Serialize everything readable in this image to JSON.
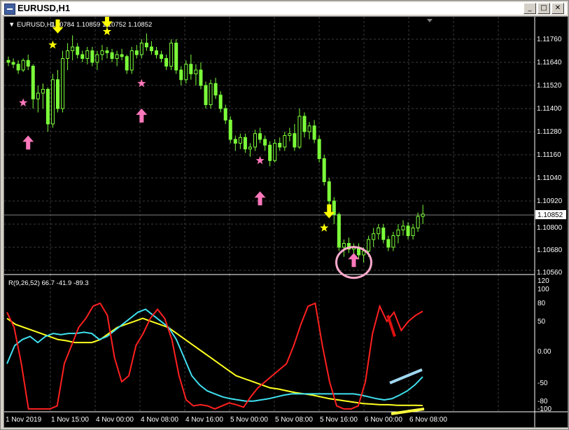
{
  "window": {
    "title": "EURUSD,H1",
    "buttons": {
      "minimize": "_",
      "maximize": "□",
      "close": "✕"
    }
  },
  "price_panel": {
    "header_symbol": "▼ EURUSD,H1",
    "header_ohlc": "1.10784 1.10859 1.10752 1.10852",
    "price_ticks": [
      "1.11760",
      "1.11640",
      "1.11520",
      "1.11400",
      "1.11280",
      "1.11160",
      "1.11040",
      "1.10920",
      "1.10800",
      "1.10680",
      "1.10560"
    ],
    "current_price": "1.10852"
  },
  "indicator_panel": {
    "label": "R(9,26,52) 66.7 -41.9 -89.3",
    "ticks": [
      "120",
      "100",
      "80",
      "50",
      "0.00",
      "-50",
      "-80",
      "-100"
    ]
  },
  "time_axis": [
    "1 Nov 2019",
    "1 Nov 15:00",
    "4 Nov 00:00",
    "4 Nov 08:00",
    "4 Nov 16:00",
    "5 Nov 00:00",
    "5 Nov 08:00",
    "5 Nov 16:00",
    "6 Nov 00:00",
    "6 Nov 08:00"
  ],
  "colors": {
    "background": "#000000",
    "grid": "#3a3a3a",
    "candle": "#7cff3a",
    "red_line": "#ff2020",
    "cyan_line": "#40e0f0",
    "yellow_line": "#ffff20",
    "buy_arrow": "#ff77bb",
    "sell_arrow": "#ffff00"
  },
  "chart_data": {
    "type": "candlestick",
    "title": "EURUSD,H1",
    "ylim": [
      1.105,
      1.118
    ],
    "candles": [
      [
        1.1165,
        1.1167,
        1.1162,
        1.1164
      ],
      [
        1.1164,
        1.1166,
        1.1161,
        1.1163
      ],
      [
        1.1163,
        1.1165,
        1.1158,
        1.116
      ],
      [
        1.116,
        1.1166,
        1.1159,
        1.1165
      ],
      [
        1.1165,
        1.1168,
        1.116,
        1.1162
      ],
      [
        1.1162,
        1.1163,
        1.114,
        1.1145
      ],
      [
        1.1145,
        1.1152,
        1.1138,
        1.1148
      ],
      [
        1.1148,
        1.1153,
        1.114,
        1.115
      ],
      [
        1.115,
        1.1151,
        1.1128,
        1.1132
      ],
      [
        1.1132,
        1.1158,
        1.113,
        1.1155
      ],
      [
        1.1155,
        1.116,
        1.1138,
        1.114
      ],
      [
        1.114,
        1.117,
        1.1138,
        1.1166
      ],
      [
        1.1166,
        1.1174,
        1.116,
        1.117
      ],
      [
        1.117,
        1.1178,
        1.1165,
        1.1172
      ],
      [
        1.1172,
        1.1174,
        1.1166,
        1.1168
      ],
      [
        1.1168,
        1.117,
        1.1164,
        1.1166
      ],
      [
        1.1166,
        1.1172,
        1.1163,
        1.117
      ],
      [
        1.117,
        1.1172,
        1.1162,
        1.1164
      ],
      [
        1.1164,
        1.117,
        1.116,
        1.1168
      ],
      [
        1.1168,
        1.1173,
        1.1165,
        1.117
      ],
      [
        1.117,
        1.1172,
        1.1166,
        1.1169
      ],
      [
        1.1169,
        1.1171,
        1.1164,
        1.1166
      ],
      [
        1.1166,
        1.117,
        1.1162,
        1.1168
      ],
      [
        1.1168,
        1.1171,
        1.1165,
        1.1167
      ],
      [
        1.1167,
        1.1168,
        1.1158,
        1.116
      ],
      [
        1.116,
        1.1172,
        1.1158,
        1.117
      ],
      [
        1.117,
        1.1173,
        1.1166,
        1.1168
      ],
      [
        1.1168,
        1.1176,
        1.1166,
        1.1174
      ],
      [
        1.1174,
        1.1179,
        1.117,
        1.1172
      ],
      [
        1.1172,
        1.1175,
        1.1168,
        1.117
      ],
      [
        1.117,
        1.1172,
        1.1166,
        1.1168
      ],
      [
        1.1168,
        1.117,
        1.1164,
        1.1166
      ],
      [
        1.1166,
        1.1168,
        1.116,
        1.1162
      ],
      [
        1.1162,
        1.1176,
        1.116,
        1.1174
      ],
      [
        1.1174,
        1.1176,
        1.1158,
        1.116
      ],
      [
        1.116,
        1.1162,
        1.1152,
        1.1155
      ],
      [
        1.1155,
        1.1165,
        1.1153,
        1.1163
      ],
      [
        1.1163,
        1.1168,
        1.1155,
        1.1158
      ],
      [
        1.1158,
        1.1163,
        1.1152,
        1.116
      ],
      [
        1.116,
        1.1164,
        1.115,
        1.1152
      ],
      [
        1.1152,
        1.1154,
        1.114,
        1.1142
      ],
      [
        1.1142,
        1.1155,
        1.114,
        1.1153
      ],
      [
        1.1153,
        1.1156,
        1.1145,
        1.1147
      ],
      [
        1.1147,
        1.1149,
        1.1138,
        1.114
      ],
      [
        1.114,
        1.1142,
        1.1132,
        1.1134
      ],
      [
        1.1134,
        1.1136,
        1.1122,
        1.1124
      ],
      [
        1.1124,
        1.1126,
        1.1118,
        1.1122
      ],
      [
        1.1122,
        1.1127,
        1.1119,
        1.1125
      ],
      [
        1.1125,
        1.1127,
        1.1117,
        1.1119
      ],
      [
        1.1119,
        1.1122,
        1.1115,
        1.112
      ],
      [
        1.112,
        1.1129,
        1.1118,
        1.1127
      ],
      [
        1.1127,
        1.113,
        1.1122,
        1.1124
      ],
      [
        1.1124,
        1.1126,
        1.1118,
        1.1121
      ],
      [
        1.1121,
        1.1123,
        1.111,
        1.1113
      ],
      [
        1.1113,
        1.1124,
        1.1112,
        1.1122
      ],
      [
        1.1122,
        1.1125,
        1.1118,
        1.112
      ],
      [
        1.112,
        1.1128,
        1.1118,
        1.1126
      ],
      [
        1.1126,
        1.113,
        1.1123,
        1.1127
      ],
      [
        1.1127,
        1.1132,
        1.1118,
        1.112
      ],
      [
        1.112,
        1.114,
        1.1119,
        1.1136
      ],
      [
        1.1136,
        1.1138,
        1.1125,
        1.1128
      ],
      [
        1.1128,
        1.1133,
        1.1124,
        1.1131
      ],
      [
        1.1131,
        1.1134,
        1.1122,
        1.1124
      ],
      [
        1.1124,
        1.1126,
        1.1112,
        1.1114
      ],
      [
        1.1114,
        1.1116,
        1.11,
        1.1102
      ],
      [
        1.1102,
        1.1104,
        1.109,
        1.1092
      ],
      [
        1.1092,
        1.1094,
        1.108,
        1.1085
      ],
      [
        1.1085,
        1.1086,
        1.1066,
        1.1068
      ],
      [
        1.1068,
        1.1072,
        1.1063,
        1.107
      ],
      [
        1.107,
        1.1073,
        1.1065,
        1.1067
      ],
      [
        1.1067,
        1.107,
        1.1064,
        1.1068
      ],
      [
        1.1068,
        1.107,
        1.1062,
        1.1064
      ],
      [
        1.1064,
        1.1068,
        1.106,
        1.1066
      ],
      [
        1.1066,
        1.1074,
        1.1063,
        1.1072
      ],
      [
        1.1072,
        1.1078,
        1.1068,
        1.1075
      ],
      [
        1.1075,
        1.108,
        1.1072,
        1.1078
      ],
      [
        1.1078,
        1.108,
        1.107,
        1.1072
      ],
      [
        1.1072,
        1.1074,
        1.1066,
        1.1068
      ],
      [
        1.1068,
        1.1076,
        1.1066,
        1.1074
      ],
      [
        1.1074,
        1.108,
        1.107,
        1.1077
      ],
      [
        1.1077,
        1.1082,
        1.1074,
        1.1079
      ],
      [
        1.1079,
        1.1081,
        1.1072,
        1.1074
      ],
      [
        1.1074,
        1.108,
        1.1072,
        1.1078
      ],
      [
        1.1078,
        1.1086,
        1.1076,
        1.1084
      ],
      [
        1.1084,
        1.109,
        1.108,
        1.10852
      ]
    ],
    "indicator": {
      "name": "R(9,26,52)",
      "ylim": [
        -110,
        125
      ],
      "red": [
        65,
        40,
        -20,
        -95,
        -95,
        -95,
        -95,
        -90,
        -20,
        10,
        40,
        55,
        75,
        80,
        60,
        -10,
        -50,
        -40,
        10,
        30,
        55,
        70,
        55,
        20,
        -40,
        -80,
        -90,
        -88,
        -90,
        -95,
        -90,
        -85,
        -88,
        -92,
        -75,
        -60,
        -50,
        -40,
        -30,
        -20,
        10,
        45,
        75,
        80,
        10,
        -50,
        -90,
        -95,
        -95,
        -90,
        -50,
        30,
        75,
        50,
        65,
        35,
        50,
        60,
        66.7
      ],
      "cyan": [
        -20,
        10,
        20,
        25,
        15,
        25,
        30,
        28,
        30,
        30,
        32,
        30,
        20,
        25,
        35,
        45,
        55,
        65,
        70,
        60,
        50,
        40,
        20,
        -10,
        -40,
        -55,
        -65,
        -70,
        -75,
        -78,
        -80,
        -82,
        -82,
        -80,
        -78,
        -75,
        -72,
        -70,
        -70,
        -70,
        -70,
        -70,
        -70,
        -70,
        -70,
        -70,
        -72,
        -75,
        -78,
        -80,
        -78,
        -72,
        -65,
        -55,
        -41.9
      ],
      "yellow": [
        55,
        45,
        40,
        35,
        30,
        25,
        20,
        18,
        15,
        15,
        15,
        20,
        30,
        40,
        45,
        50,
        55,
        50,
        45,
        40,
        30,
        20,
        10,
        0,
        -10,
        -20,
        -30,
        -40,
        -45,
        -50,
        -55,
        -60,
        -62,
        -65,
        -68,
        -70,
        -72,
        -75,
        -78,
        -80,
        -82,
        -84,
        -86,
        -87,
        -88,
        -88,
        -89,
        -89,
        -89,
        -89.3
      ],
      "annotations": {
        "red_segment": [
          [
            548,
            60
          ],
          [
            558,
            25
          ]
        ],
        "blue_segment": [
          [
            551,
            -52
          ],
          [
            597,
            -30
          ]
        ],
        "yellow_segment": [
          [
            553,
            -103
          ],
          [
            600,
            -95
          ]
        ]
      }
    },
    "signals": {
      "buy_arrows": [
        {
          "index": 4,
          "price": 1.1126
        },
        {
          "index": 27,
          "price": 1.114
        },
        {
          "index": 51,
          "price": 1.1097
        },
        {
          "index": 70,
          "price": 1.1065
        }
      ],
      "sell_arrows": [
        {
          "index": 10,
          "price": 1.1179
        },
        {
          "index": 20,
          "price": 1.1182
        },
        {
          "index": 65,
          "price": 1.1083
        }
      ],
      "pink_stars": [
        {
          "index": 3,
          "price": 1.1143
        },
        {
          "index": 27,
          "price": 1.1153
        },
        {
          "index": 51,
          "price": 1.1113
        }
      ],
      "yellow_stars": [
        {
          "index": 9,
          "price": 1.1173
        },
        {
          "index": 20,
          "price": 1.118
        },
        {
          "index": 64,
          "price": 1.1078
        }
      ],
      "circle": {
        "index": 70,
        "price": 1.1063
      }
    }
  }
}
